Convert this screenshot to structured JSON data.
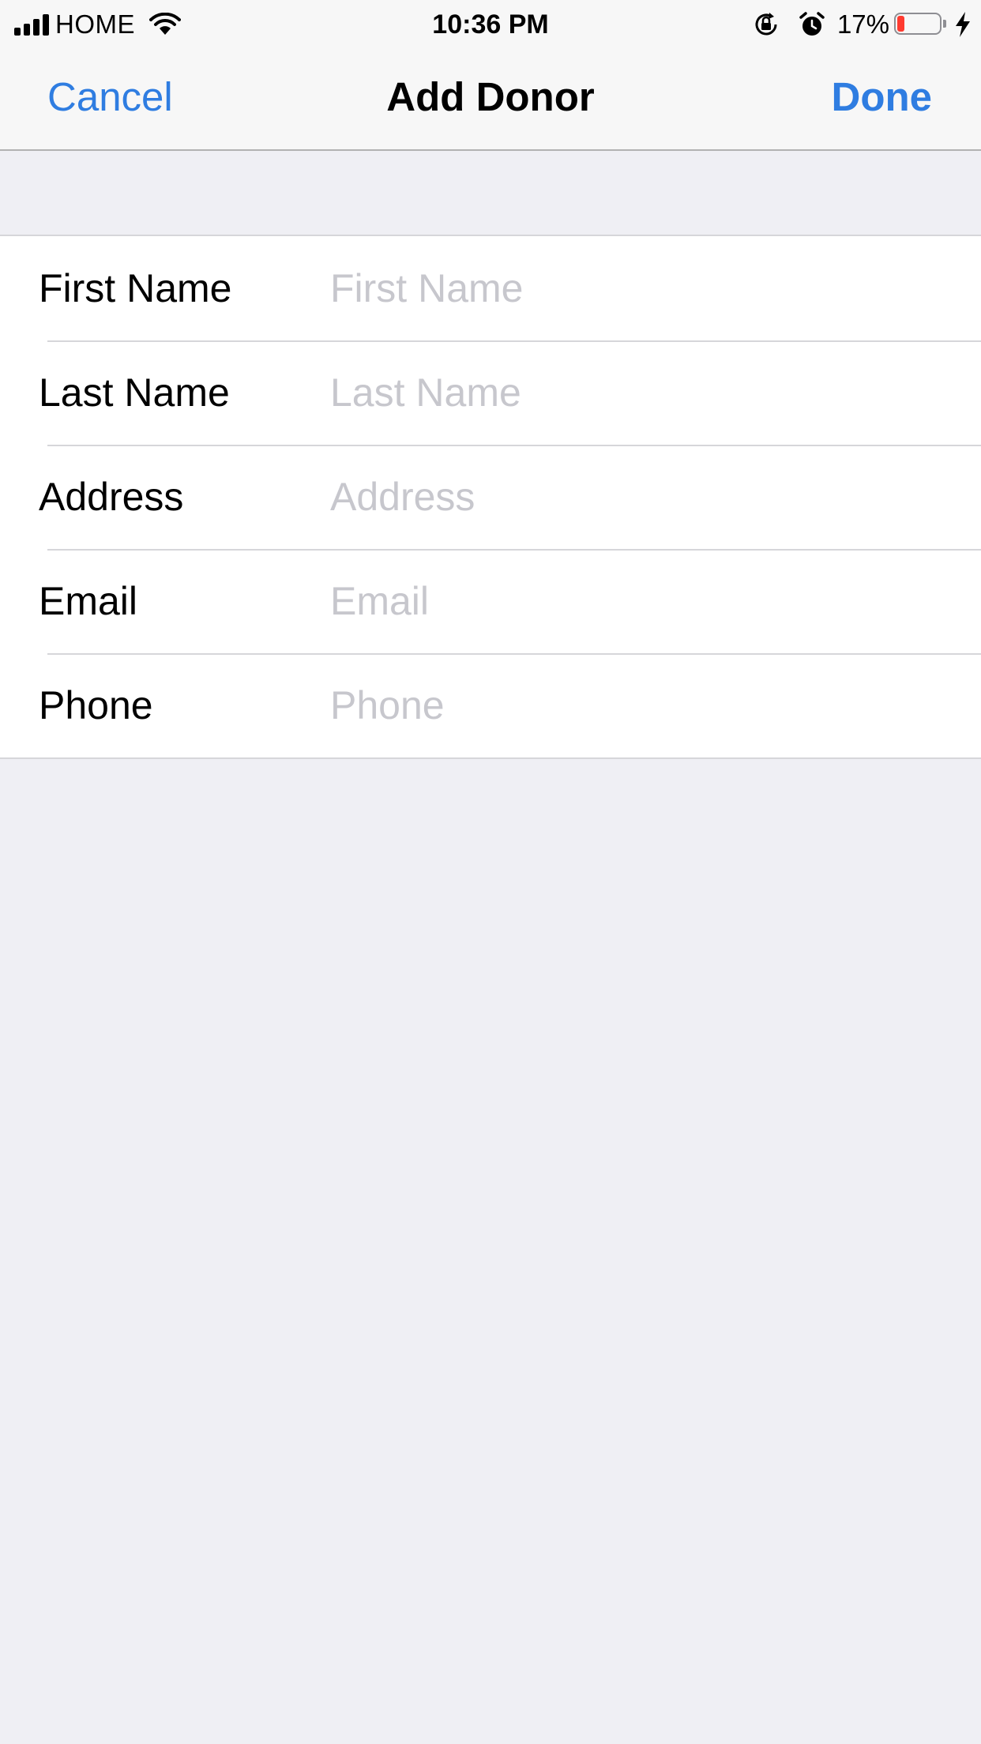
{
  "status_bar": {
    "carrier": "HOME",
    "time": "10:36 PM",
    "battery_percent": "17%",
    "battery_level": 0.17,
    "icons": [
      "signal-icon",
      "wifi-icon",
      "orientation-lock-icon",
      "alarm-icon",
      "battery-icon",
      "charging-icon"
    ]
  },
  "nav": {
    "cancel_label": "Cancel",
    "title": "Add Donor",
    "done_label": "Done"
  },
  "form": {
    "fields": [
      {
        "label": "First Name",
        "placeholder": "First Name",
        "value": ""
      },
      {
        "label": "Last Name",
        "placeholder": "Last Name",
        "value": ""
      },
      {
        "label": "Address",
        "placeholder": "Address",
        "value": ""
      },
      {
        "label": "Email",
        "placeholder": "Email",
        "value": ""
      },
      {
        "label": "Phone",
        "placeholder": "Phone",
        "value": ""
      }
    ]
  },
  "colors": {
    "accent": "#2f7de1",
    "background": "#efeff4",
    "placeholder": "#c7c7cd",
    "battery_low": "#ff3b30"
  }
}
